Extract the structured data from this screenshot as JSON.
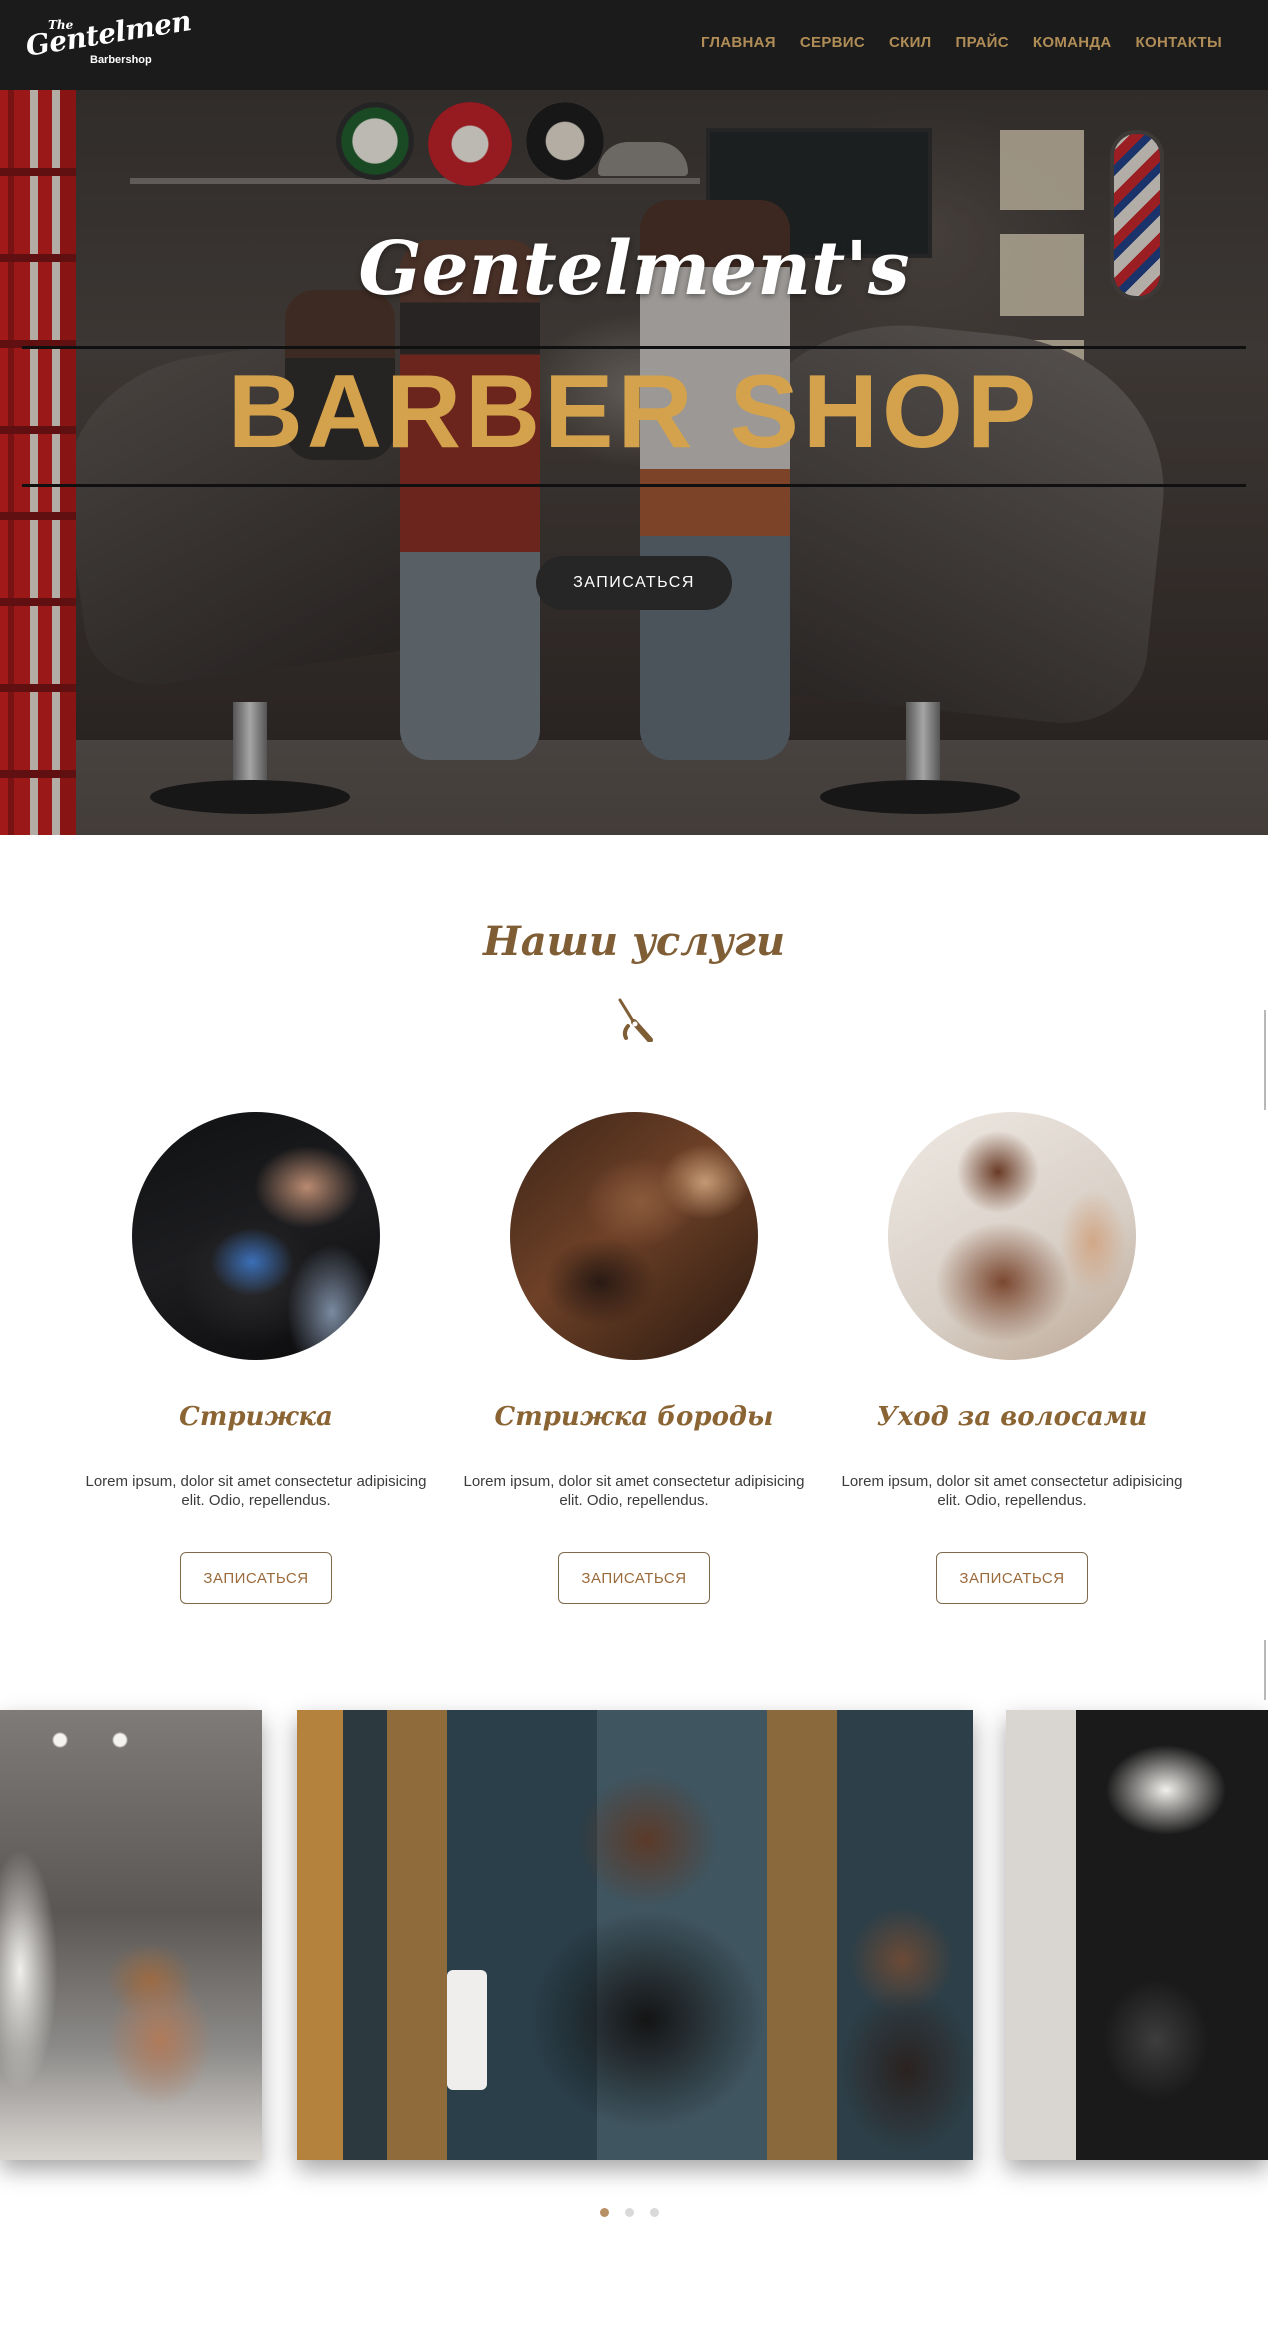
{
  "brand": {
    "logo_top": "The",
    "logo_main": "Gentelmen",
    "logo_sub": "Barbershop"
  },
  "nav": {
    "items": [
      {
        "label": "ГЛАВНАЯ"
      },
      {
        "label": "СЕРВИС"
      },
      {
        "label": "СКИЛ"
      },
      {
        "label": "ПРАЙС"
      },
      {
        "label": "КОМАНДА"
      },
      {
        "label": "КОНТАКТЫ"
      }
    ]
  },
  "hero": {
    "script_title": "Gentelment's",
    "main_title": "BARBER SHOP",
    "cta_label": "ЗАПИСАТЬСЯ"
  },
  "services": {
    "title": "Наши услуги",
    "icon": "razor-icon",
    "cards": [
      {
        "name": "Стрижка",
        "description": "Lorem ipsum, dolor sit amet consectetur adipisicing elit. Odio, repellendus.",
        "button": "ЗАПИСАТЬСЯ"
      },
      {
        "name": "Стрижка бороды",
        "description": "Lorem ipsum, dolor sit amet consectetur adipisicing elit. Odio, repellendus.",
        "button": "ЗАПИСАТЬСЯ"
      },
      {
        "name": "Уход за волосами",
        "description": "Lorem ipsum, dolor sit amet consectetur adipisicing elit. Odio, repellendus.",
        "button": "ЗАПИСАТЬСЯ"
      }
    ]
  },
  "slider": {
    "slide_count": 3,
    "active_index": 0
  },
  "colors": {
    "nav_bg": "#1b1b1b",
    "accent_gold": "#d4a24c",
    "nav_link": "#b08d57",
    "heading_brown": "#7f5d35",
    "dot_active": "#b79064",
    "dot_inactive": "#d9d9d9"
  }
}
